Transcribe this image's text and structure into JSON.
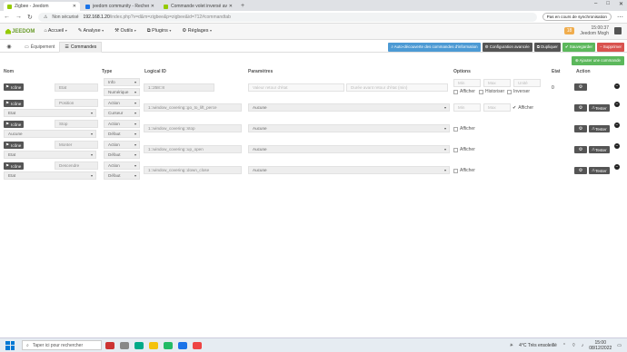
{
  "browser": {
    "tabs": [
      {
        "label": "Zigbee - Jeedom",
        "icon_color": "#94ca02",
        "active": true
      },
      {
        "label": "jeedom community - Recherche",
        "icon_color": "#1a73e8",
        "active": false
      },
      {
        "label": "Commande volet inversé avec la",
        "icon_color": "#94ca02",
        "active": false
      }
    ],
    "newtab": "+",
    "window_controls": [
      "–",
      "□",
      "✕"
    ],
    "security": "Non sécurisé",
    "url_host": "192.168.1.20",
    "url_path": "/index.php?v=d&m=zigbee&p=zigbee&id=712#commandtab",
    "sync_button": "Pas en cours de synchronisation"
  },
  "app": {
    "logo": "JEEDOM",
    "menu": [
      "Accueil",
      "Analyse",
      "Outils",
      "Plugins",
      "Réglages"
    ],
    "badge": "18",
    "clock": "15:00:37",
    "user": "Jeedom Mogh"
  },
  "toolbar": {
    "tabs": [
      "Équipement",
      "Commandes"
    ],
    "actions": [
      {
        "label": "Auto-découverte des commandes d'information",
        "color": "#4c9ad4"
      },
      {
        "label": "Configuration avancée",
        "color": "#555"
      },
      {
        "label": "Dupliquer",
        "color": "#555"
      },
      {
        "label": "Sauvegarder",
        "color": "#5cb85c"
      },
      {
        "label": "Supprimer",
        "color": "#d9534f"
      }
    ],
    "add_command": "Ajouter une commande"
  },
  "headers": {
    "name": "Nom",
    "type": "Type",
    "logical": "Logical ID",
    "params": "Paramètres",
    "options": "Options",
    "state": "Etat",
    "action": "Action"
  },
  "icon_label": "Icône",
  "rows": [
    {
      "name": "Etat",
      "type": "Info",
      "subtype": "Numérique",
      "logical": "1::258::8",
      "param1": "Valeur retour d'état",
      "param2": "Durée avant retour d'état (min)",
      "min": "Min",
      "max": "Max",
      "unit": "Unité",
      "opts": [
        "Afficher",
        "Historiser",
        "Inverser"
      ],
      "state": "0"
    },
    {
      "name": "Position",
      "value_sel": "Etat",
      "type": "Action",
      "subtype": "Curseur",
      "logical": "1::window_covering::go_to_lift_perce",
      "param": "Aucune",
      "min": "Min",
      "max": "Max",
      "opts": [
        "Afficher"
      ]
    },
    {
      "name": "Stop",
      "value_sel": "Aucune",
      "type": "Action",
      "subtype": "Défaut",
      "logical": "1::window_covering::stop",
      "param": "Aucune",
      "opts": [
        "Afficher"
      ]
    },
    {
      "name": "Monter",
      "value_sel": "Etat",
      "type": "Action",
      "subtype": "Défaut",
      "logical": "1::window_covering::up_open",
      "param": "Aucune",
      "opts": [
        "Afficher"
      ]
    },
    {
      "name": "Descendre",
      "value_sel": "Etat",
      "type": "Action",
      "subtype": "Défaut",
      "logical": "1::window_covering::down_close",
      "param": "Aucune",
      "opts": [
        "Afficher"
      ]
    }
  ],
  "row_buttons": {
    "test": "Tester",
    "minus": "−"
  },
  "taskbar": {
    "search": "Taper ici pour rechercher",
    "weather": "4°C  Très ensoleillé",
    "time": "15:00",
    "date": "08/12/2022"
  }
}
